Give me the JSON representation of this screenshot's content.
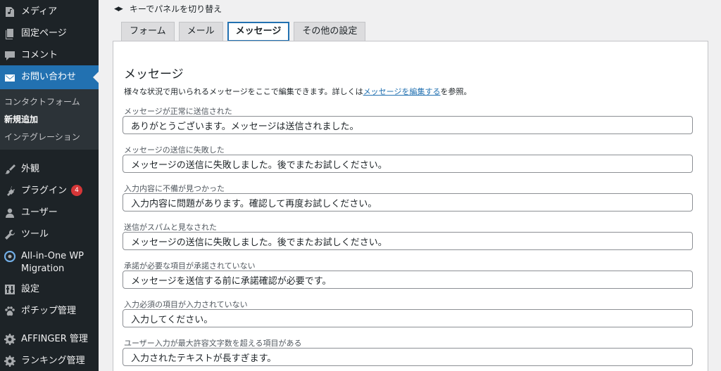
{
  "sidebar": {
    "items": [
      {
        "key": "media",
        "label": "メディア",
        "icon": "media-icon"
      },
      {
        "key": "pages",
        "label": "固定ページ",
        "icon": "pages-icon"
      },
      {
        "key": "comments",
        "label": "コメント",
        "icon": "comment-icon"
      },
      {
        "key": "contact",
        "label": "お問い合わせ",
        "icon": "mail-icon",
        "active": true
      },
      {
        "key": "appearance",
        "label": "外観",
        "icon": "brush-icon"
      },
      {
        "key": "plugins",
        "label": "プラグイン",
        "icon": "plugin-icon",
        "badge": "4"
      },
      {
        "key": "users",
        "label": "ユーザー",
        "icon": "user-icon"
      },
      {
        "key": "tools",
        "label": "ツール",
        "icon": "wrench-icon"
      },
      {
        "key": "aio",
        "label": "All-in-One WP Migration",
        "icon": "migration-icon"
      },
      {
        "key": "settings",
        "label": "設定",
        "icon": "settings-icon"
      },
      {
        "key": "pochipp",
        "label": "ポチップ管理",
        "icon": "paw-icon"
      },
      {
        "key": "affinger",
        "label": "AFFINGER 管理",
        "icon": "gear-icon"
      },
      {
        "key": "ranking",
        "label": "ランキング管理",
        "icon": "gear-icon"
      }
    ],
    "submenu": [
      {
        "label": "コンタクトフォーム"
      },
      {
        "label": "新規追加",
        "current": true
      },
      {
        "label": "インテグレーション"
      }
    ]
  },
  "hint": "キーでパネルを切り替え",
  "tabs": [
    "フォーム",
    "メール",
    "メッセージ",
    "その他の設定"
  ],
  "selected_tab": "メッセージ",
  "panel": {
    "title": "メッセージ",
    "desc_before": "様々な状況で用いられるメッセージをここで編集できます。詳しくは",
    "desc_link": "メッセージを編集する",
    "desc_after": "を参照。",
    "fields": [
      {
        "label": "メッセージが正常に送信された",
        "value": "ありがとうございます。メッセージは送信されました。"
      },
      {
        "label": "メッセージの送信に失敗した",
        "value": "メッセージの送信に失敗しました。後でまたお試しください。"
      },
      {
        "label": "入力内容に不備が見つかった",
        "value": "入力内容に問題があります。確認して再度お試しください。"
      },
      {
        "label": "送信がスパムと見なされた",
        "value": "メッセージの送信に失敗しました。後でまたお試しください。"
      },
      {
        "label": "承諾が必要な項目が承諾されていない",
        "value": "メッセージを送信する前に承諾確認が必要です。"
      },
      {
        "label": "入力必須の項目が入力されていない",
        "value": "入力してください。"
      },
      {
        "label": "ユーザー入力が最大許容文字数を超える項目がある",
        "value": "入力されたテキストが長すぎます。"
      }
    ]
  },
  "colors": {
    "sidebar_bg": "#1d2327",
    "accent": "#2271b1",
    "badge": "#d63638",
    "page_bg": "#f0f0f1"
  }
}
